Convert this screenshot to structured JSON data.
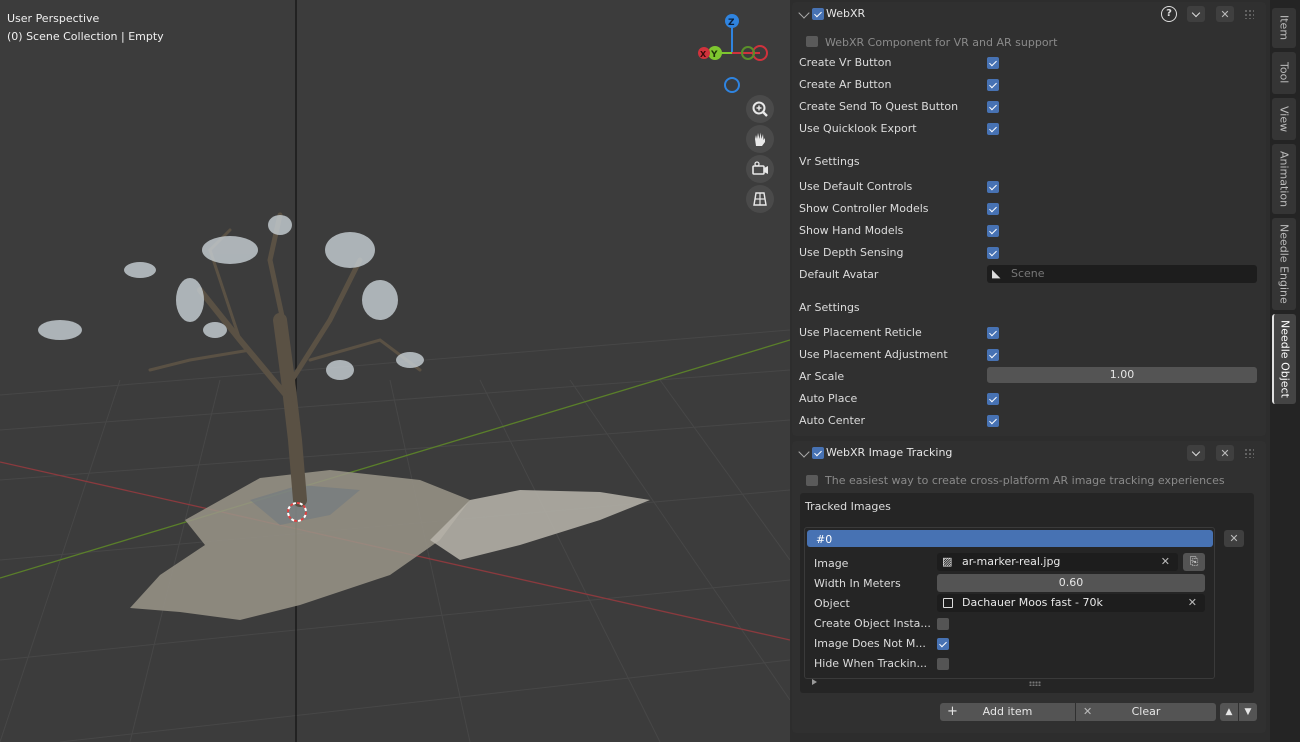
{
  "viewport": {
    "line1": "User Perspective",
    "line2": "(0) Scene Collection | Empty",
    "gizmo": {
      "z": "Z",
      "y": "Y",
      "x": "X"
    },
    "nav_icons": [
      "zoom-icon",
      "hand-pan-icon",
      "camera-icon",
      "grid-ortho-icon"
    ]
  },
  "webxr": {
    "title": "WebXR",
    "info": "WebXR Component for VR and AR support",
    "rows1": [
      {
        "label": "Create Vr Button",
        "checked": true
      },
      {
        "label": "Create Ar Button",
        "checked": true
      },
      {
        "label": "Create Send To Quest Button",
        "checked": true
      },
      {
        "label": "Use Quicklook Export",
        "checked": true
      }
    ],
    "vr_heading": "Vr Settings",
    "rows2": [
      {
        "label": "Use Default Controls",
        "checked": true
      },
      {
        "label": "Show Controller Models",
        "checked": true
      },
      {
        "label": "Show Hand Models",
        "checked": true
      },
      {
        "label": "Use Depth Sensing",
        "checked": true
      }
    ],
    "avatar_label": "Default Avatar",
    "avatar_placeholder": "Scene",
    "ar_heading": "Ar Settings",
    "rows3": [
      {
        "label": "Use Placement Reticle",
        "checked": true
      },
      {
        "label": "Use Placement Adjustment",
        "checked": true
      }
    ],
    "ar_scale_label": "Ar Scale",
    "ar_scale_value": "1.00",
    "rows4": [
      {
        "label": "Auto Place",
        "checked": true
      },
      {
        "label": "Auto Center",
        "checked": true
      }
    ]
  },
  "tracking": {
    "title": "WebXR Image Tracking",
    "info": "The easiest way to create cross-platform AR image tracking experiences",
    "tracked_heading": "Tracked Images",
    "item_name": "#0",
    "image_label": "Image",
    "image_value": "ar-marker-real.jpg",
    "width_label": "Width In Meters",
    "width_value": "0.60",
    "object_label": "Object",
    "object_value": "Dachauer Moos fast - 70k",
    "opts": [
      {
        "label": "Create Object Insta...",
        "checked": false
      },
      {
        "label": "Image Does Not M...",
        "checked": true
      },
      {
        "label": "Hide When Trackin...",
        "checked": false
      }
    ],
    "add_item": "Add item",
    "clear": "Clear"
  },
  "tabs": [
    "Item",
    "Tool",
    "View",
    "Animation",
    "Needle Engine",
    "Needle Object"
  ],
  "colors": {
    "accent": "#4772b3",
    "x_axis": "#d0323c",
    "y_axis": "#7ec62f",
    "z_axis": "#2f84e0"
  }
}
